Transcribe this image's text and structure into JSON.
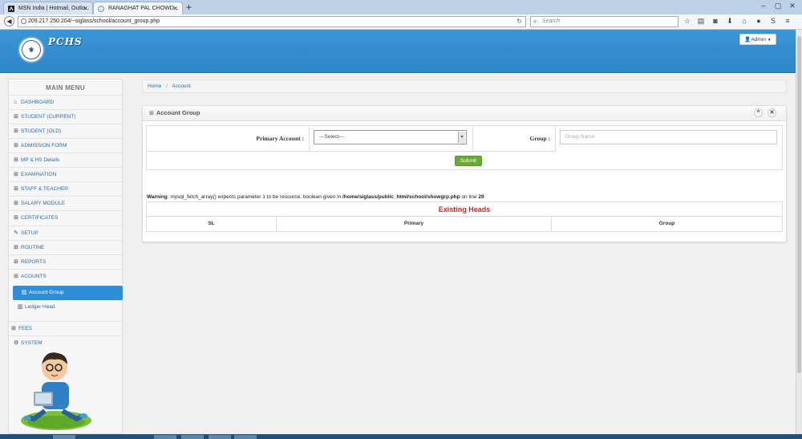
{
  "browser": {
    "tabs": [
      {
        "title": "MSN India | Hotmail, Outlo..."
      },
      {
        "title": "RANAGHAT PAL CHOWD..."
      }
    ],
    "new_tab": "+",
    "address": "209.217.250.204/~siglass/school/account_group.php",
    "search_placeholder": "Search"
  },
  "app": {
    "brand": "PCHS",
    "admin_label": "Admin"
  },
  "sidebar": {
    "title": "MAIN MENU",
    "items": [
      {
        "label": "DASHBOARD",
        "icon": "home-icon"
      },
      {
        "label": "STUDENT (CURRENT)",
        "icon": "grid-icon"
      },
      {
        "label": "STUDENT (OLD)",
        "icon": "grid-icon"
      },
      {
        "label": "ADMISSION FORM",
        "icon": "grid-icon"
      },
      {
        "label": "MP & HS Details",
        "icon": "grid-icon"
      },
      {
        "label": "EXAMINATION",
        "icon": "grid-icon"
      },
      {
        "label": "STAFF & TEACHER",
        "icon": "grid-icon"
      },
      {
        "label": "SALARY MODULE",
        "icon": "grid-icon"
      },
      {
        "label": "CERTIFICATES",
        "icon": "grid-icon"
      },
      {
        "label": "SETUP",
        "icon": "wrench-icon"
      },
      {
        "label": "ROUTINE",
        "icon": "grid-icon"
      },
      {
        "label": "REPORTS",
        "icon": "grid-icon"
      },
      {
        "label": "ACOUNTS",
        "icon": "grid-icon"
      }
    ],
    "sub_items": [
      {
        "label": "Account Group",
        "icon": "book-icon",
        "active": true
      },
      {
        "label": "Ledger Head",
        "icon": "book-icon",
        "active": false
      }
    ],
    "tail_items": [
      {
        "label": "FEES",
        "icon": "grid-icon"
      },
      {
        "label": "SYSTEM",
        "icon": "cogs-icon"
      }
    ]
  },
  "breadcrumb": {
    "home": "Home",
    "separator": "/",
    "current": "Account"
  },
  "panel": {
    "title": "Account Group",
    "form": {
      "primary_label": "Primary Account :",
      "primary_value": "---Select---",
      "group_label": "Group :",
      "group_placeholder": "Group Name",
      "submit_label": "Submit"
    },
    "warning": {
      "prefix": "Warning",
      "message": ": mysql_fetch_array() expects parameter 1 to be resource, boolean given in ",
      "path": "/home/siglass/public_html/school/showgrp.php",
      "line_text": " on line ",
      "line": "29"
    },
    "table": {
      "title": "Existing Heads",
      "columns": [
        "SL",
        "Primary",
        "Group"
      ]
    }
  },
  "colors": {
    "header_blue": "#3a96d6",
    "active_item": "#2f8ed6",
    "submit_green": "#6aa935",
    "heads_red": "#e02020"
  }
}
